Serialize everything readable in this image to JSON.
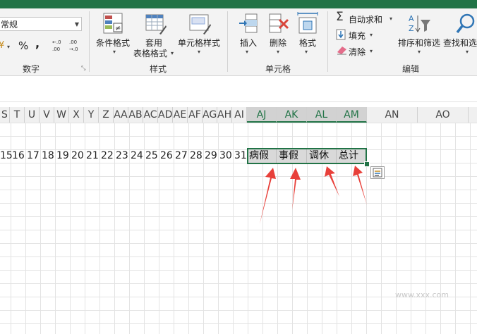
{
  "colors": {
    "accent": "#217346",
    "arrow": "#e8403a"
  },
  "ribbon": {
    "number_format_value": "常规",
    "number_group_label": "数字",
    "percent_symbol": "%",
    "comma_symbol": ",",
    "inc_decimal": ".0→.00",
    "dec_decimal": ".00→.0",
    "styles_group_label": "样式",
    "conditional_format_label": "条件格式",
    "table_format_label_1": "套用",
    "table_format_label_2": "表格格式",
    "cell_styles_label": "单元格样式",
    "cells_group_label": "单元格",
    "insert_label": "插入",
    "delete_label": "删除",
    "format_label": "格式",
    "editing_group_label": "编辑",
    "autosum_label": "自动求和",
    "fill_label": "填充",
    "clear_label": "清除",
    "sort_filter_label": "排序和筛选",
    "find_select_label": "查找和选"
  },
  "sheet": {
    "columns": [
      "S",
      "T",
      "U",
      "V",
      "W",
      "X",
      "Y",
      "Z",
      "AA",
      "AB",
      "AC",
      "AD",
      "AE",
      "AF",
      "AG",
      "AH",
      "AI",
      "AJ",
      "AK",
      "AL",
      "AM",
      "AN",
      "AO"
    ],
    "row_numbers": [
      "15",
      "16",
      "17",
      "18",
      "19",
      "20",
      "21",
      "22",
      "23",
      "24",
      "25",
      "26",
      "27",
      "28",
      "29",
      "30",
      "31"
    ],
    "header_cells": [
      "病假",
      "事假",
      "调休",
      "总计"
    ]
  },
  "watermark": "www.xxx.com"
}
